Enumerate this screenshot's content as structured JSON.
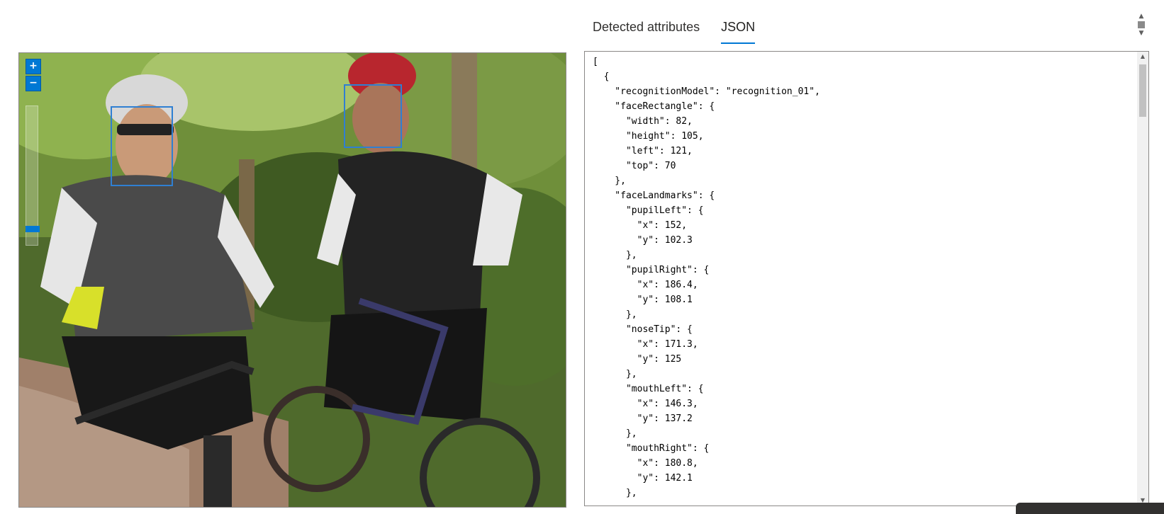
{
  "tabs": [
    {
      "label": "Detected attributes",
      "active": false
    },
    {
      "label": "JSON",
      "active": true
    }
  ],
  "zoom": {
    "in_icon": "plus-icon",
    "out_icon": "minus-icon"
  },
  "json_lines": [
    "[",
    "  {",
    "    \"recognitionModel\": \"recognition_01\",",
    "    \"faceRectangle\": {",
    "      \"width\": 82,",
    "      \"height\": 105,",
    "      \"left\": 121,",
    "      \"top\": 70",
    "    },",
    "    \"faceLandmarks\": {",
    "      \"pupilLeft\": {",
    "        \"x\": 152,",
    "        \"y\": 102.3",
    "      },",
    "      \"pupilRight\": {",
    "        \"x\": 186.4,",
    "        \"y\": 108.1",
    "      },",
    "      \"noseTip\": {",
    "        \"x\": 171.3,",
    "        \"y\": 125",
    "      },",
    "      \"mouthLeft\": {",
    "        \"x\": 146.3,",
    "        \"y\": 137.2",
    "      },",
    "      \"mouthRight\": {",
    "        \"x\": 180.8,",
    "        \"y\": 142.1",
    "      },"
  ],
  "colors": {
    "accent": "#0078d4",
    "face_box": "#2f7fd2"
  }
}
